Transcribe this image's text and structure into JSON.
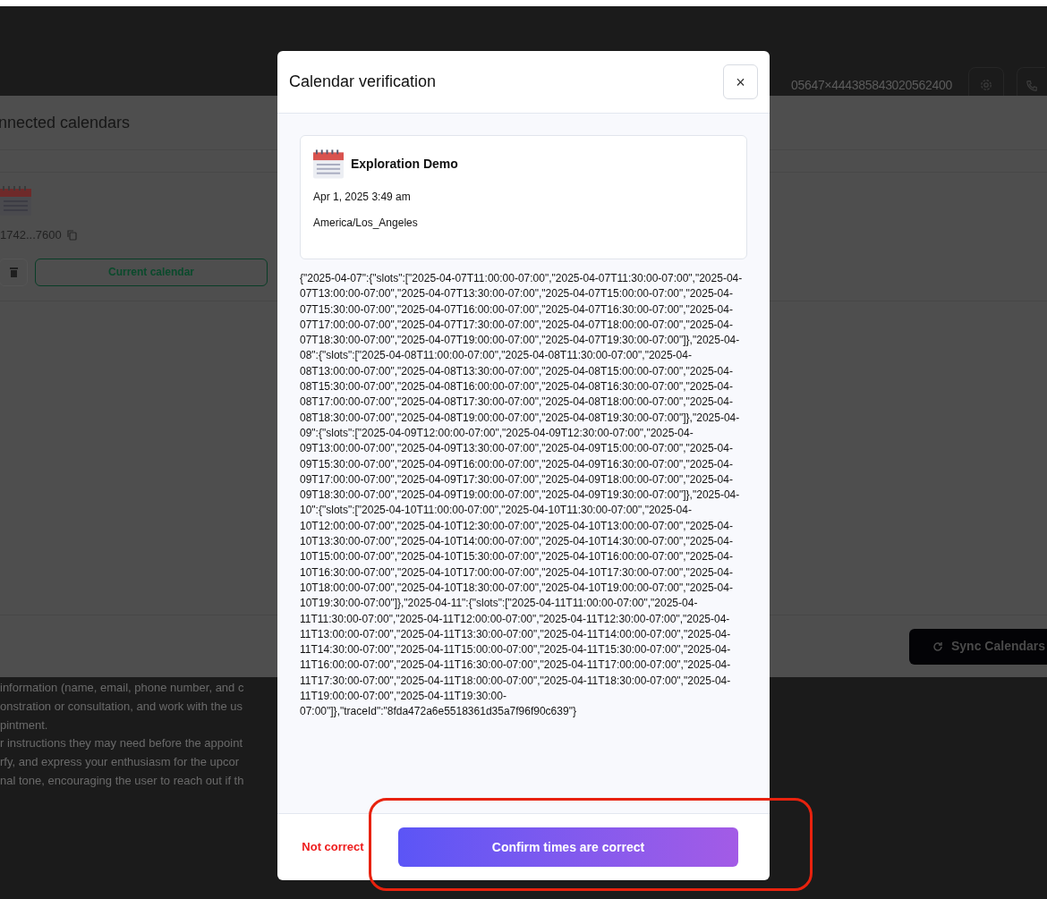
{
  "header": {
    "id_text": "05647×444385843020562400"
  },
  "panel": {
    "title": "nnected calendars",
    "calendar": {
      "id": "1742...7600",
      "current_button": "Current calendar"
    },
    "sync_button": "Sync Calendars"
  },
  "background_text": [
    "information (name, email, phone number, and c",
    "onstration or consultation, and work with the us",
    "pintment.",
    "r instructions they may need before the appoint",
    "rfy, and express your enthusiasm for the upcor",
    "nal tone, encouraging the user to reach out if th"
  ],
  "dialog": {
    "title": "Calendar verification",
    "close": "×",
    "card": {
      "title": "Exploration Demo",
      "date": "Apr 1, 2025 3:49 am",
      "timezone": "America/Los_Angeles"
    },
    "response": "{\"2025-04-07\":{\"slots\":[\"2025-04-07T11:00:00-07:00\",\"2025-04-07T11:30:00-07:00\",\"2025-04-07T13:00:00-07:00\",\"2025-04-07T13:30:00-07:00\",\"2025-04-07T15:00:00-07:00\",\"2025-04-07T15:30:00-07:00\",\"2025-04-07T16:00:00-07:00\",\"2025-04-07T16:30:00-07:00\",\"2025-04-07T17:00:00-07:00\",\"2025-04-07T17:30:00-07:00\",\"2025-04-07T18:00:00-07:00\",\"2025-04-07T18:30:00-07:00\",\"2025-04-07T19:00:00-07:00\",\"2025-04-07T19:30:00-07:00\"]},\"2025-04-08\":{\"slots\":[\"2025-04-08T11:00:00-07:00\",\"2025-04-08T11:30:00-07:00\",\"2025-04-08T13:00:00-07:00\",\"2025-04-08T13:30:00-07:00\",\"2025-04-08T15:00:00-07:00\",\"2025-04-08T15:30:00-07:00\",\"2025-04-08T16:00:00-07:00\",\"2025-04-08T16:30:00-07:00\",\"2025-04-08T17:00:00-07:00\",\"2025-04-08T17:30:00-07:00\",\"2025-04-08T18:00:00-07:00\",\"2025-04-08T18:30:00-07:00\",\"2025-04-08T19:00:00-07:00\",\"2025-04-08T19:30:00-07:00\"]},\"2025-04-09\":{\"slots\":[\"2025-04-09T12:00:00-07:00\",\"2025-04-09T12:30:00-07:00\",\"2025-04-09T13:00:00-07:00\",\"2025-04-09T13:30:00-07:00\",\"2025-04-09T15:00:00-07:00\",\"2025-04-09T15:30:00-07:00\",\"2025-04-09T16:00:00-07:00\",\"2025-04-09T16:30:00-07:00\",\"2025-04-09T17:00:00-07:00\",\"2025-04-09T17:30:00-07:00\",\"2025-04-09T18:00:00-07:00\",\"2025-04-09T18:30:00-07:00\",\"2025-04-09T19:00:00-07:00\",\"2025-04-09T19:30:00-07:00\"]},\"2025-04-10\":{\"slots\":[\"2025-04-10T11:00:00-07:00\",\"2025-04-10T11:30:00-07:00\",\"2025-04-10T12:00:00-07:00\",\"2025-04-10T12:30:00-07:00\",\"2025-04-10T13:00:00-07:00\",\"2025-04-10T13:30:00-07:00\",\"2025-04-10T14:00:00-07:00\",\"2025-04-10T14:30:00-07:00\",\"2025-04-10T15:00:00-07:00\",\"2025-04-10T15:30:00-07:00\",\"2025-04-10T16:00:00-07:00\",\"2025-04-10T16:30:00-07:00\",\"2025-04-10T17:00:00-07:00\",\"2025-04-10T17:30:00-07:00\",\"2025-04-10T18:00:00-07:00\",\"2025-04-10T18:30:00-07:00\",\"2025-04-10T19:00:00-07:00\",\"2025-04-10T19:30:00-07:00\"]},\"2025-04-11\":{\"slots\":[\"2025-04-11T11:00:00-07:00\",\"2025-04-11T11:30:00-07:00\",\"2025-04-11T12:00:00-07:00\",\"2025-04-11T12:30:00-07:00\",\"2025-04-11T13:00:00-07:00\",\"2025-04-11T13:30:00-07:00\",\"2025-04-11T14:00:00-07:00\",\"2025-04-11T14:30:00-07:00\",\"2025-04-11T15:00:00-07:00\",\"2025-04-11T15:30:00-07:00\",\"2025-04-11T16:00:00-07:00\",\"2025-04-11T16:30:00-07:00\",\"2025-04-11T17:00:00-07:00\",\"2025-04-11T17:30:00-07:00\",\"2025-04-11T18:00:00-07:00\",\"2025-04-11T18:30:00-07:00\",\"2025-04-11T19:00:00-07:00\",\"2025-04-11T19:30:00-07:00\"]},\"traceId\":\"8fda472a6e5518361d35a7f96f90c639\"}",
    "reject_button": "Not correct",
    "confirm_button": "Confirm times are correct"
  }
}
